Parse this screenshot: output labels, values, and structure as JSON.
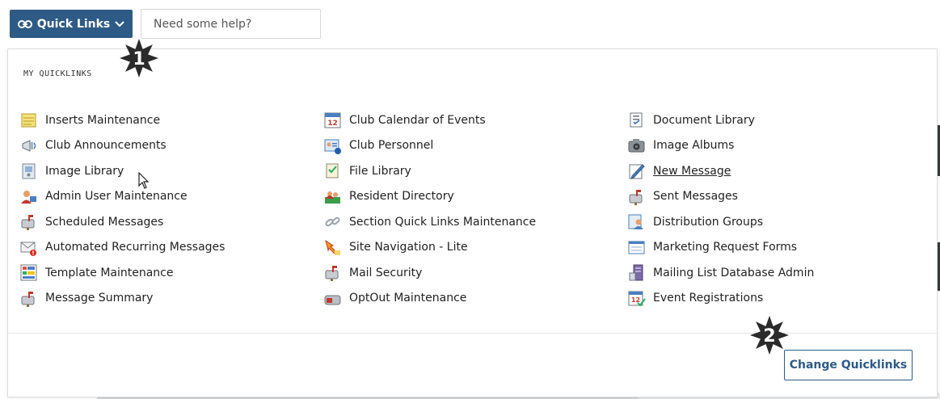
{
  "header": {
    "quicklinks_label": "Quick Links",
    "help_placeholder": "Need some help?"
  },
  "panel": {
    "title": "MY QUICKLINKS",
    "columns": [
      [
        {
          "label": "Inserts Maintenance",
          "icon": "notepad-icon"
        },
        {
          "label": "Club Announcements",
          "icon": "megaphone-icon"
        },
        {
          "label": "Image Library",
          "icon": "image-library-icon"
        },
        {
          "label": "Admin User Maintenance",
          "icon": "admin-user-icon"
        },
        {
          "label": "Scheduled Messages",
          "icon": "mailbox-icon"
        },
        {
          "label": "Automated Recurring Messages",
          "icon": "envelope-alert-icon"
        },
        {
          "label": "Template Maintenance",
          "icon": "template-grid-icon"
        },
        {
          "label": "Message Summary",
          "icon": "mailbox-icon"
        }
      ],
      [
        {
          "label": "Club Calendar of Events",
          "icon": "calendar-icon"
        },
        {
          "label": "Club Personnel",
          "icon": "personnel-card-icon"
        },
        {
          "label": "File Library",
          "icon": "file-library-icon"
        },
        {
          "label": "Resident Directory",
          "icon": "directory-icon"
        },
        {
          "label": "Section Quick Links Maintenance",
          "icon": "chain-link-icon"
        },
        {
          "label": "Site Navigation - Lite",
          "icon": "navigation-arrow-icon"
        },
        {
          "label": "Mail Security",
          "icon": "mailbox-icon"
        },
        {
          "label": "OptOut Maintenance",
          "icon": "optout-mailbox-icon"
        }
      ],
      [
        {
          "label": "Document Library",
          "icon": "document-library-icon"
        },
        {
          "label": "Image Albums",
          "icon": "camera-icon"
        },
        {
          "label": "New Message",
          "icon": "pen-paper-icon"
        },
        {
          "label": "Sent Messages",
          "icon": "mailbox-icon"
        },
        {
          "label": "Distribution Groups",
          "icon": "distribution-groups-icon"
        },
        {
          "label": "Marketing Request Forms",
          "icon": "web-form-icon"
        },
        {
          "label": "Mailing List Database Admin",
          "icon": "database-server-icon"
        },
        {
          "label": "Event Registrations",
          "icon": "calendar-check-icon"
        }
      ]
    ],
    "change_button_label": "Change Quicklinks",
    "calendar_day": "12"
  },
  "badges": [
    "1",
    "2"
  ],
  "colors": {
    "primary": "#2e5b86",
    "badge": "#2b2b2b"
  }
}
